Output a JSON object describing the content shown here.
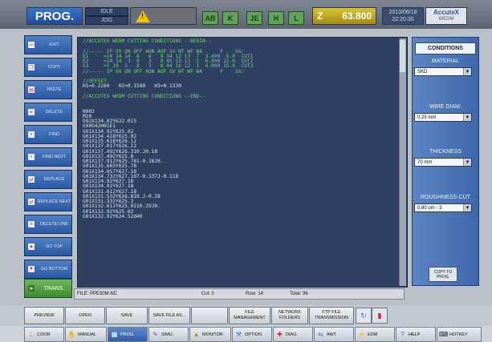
{
  "topbar": {
    "mode": "PROG.",
    "status_top": "IDLE",
    "status_bottom": "JOG",
    "warning_symbol": "!",
    "green_buttons": [
      "AB",
      "K",
      "JE",
      "H",
      "L"
    ],
    "counter_icon": "Z",
    "counter_value": "63.800",
    "date": "2013/06/18",
    "time": "22:20:30",
    "logo_brand": "AccuteX",
    "logo_sub": "WEDM"
  },
  "sidebar": {
    "items": [
      {
        "label": "EXIT",
        "icon": "exit-icon"
      },
      {
        "label": "COPY",
        "icon": "copy-icon"
      },
      {
        "label": "PASTE",
        "icon": "paste-icon"
      },
      {
        "label": "DELETE",
        "icon": "delete-icon"
      },
      {
        "label": "FIND",
        "icon": "find-icon"
      },
      {
        "label": "FIND NEXT",
        "icon": "find-next-icon"
      },
      {
        "label": "REPLACE",
        "icon": "replace-icon"
      },
      {
        "label": "REPLACE NEXT",
        "icon": "replace-next-icon"
      },
      {
        "label": "DELETE LINE",
        "icon": "delete-line-icon"
      },
      {
        "label": "GO TOP",
        "icon": "go-top-icon"
      },
      {
        "label": "GO BOTTOM",
        "icon": "go-bottom-icon"
      },
      {
        "label": "TRANS.",
        "icon": "trans-icon"
      }
    ]
  },
  "editor": {
    "lines": [
      {
        "text": "//ACCUTEX WEDM CUTTING CONDITIONS --BEGIN--",
        "color": "green"
      },
      {
        "text": "",
        "color": "green"
      },
      {
        "text": "//----- IP OV ON OFF AON AOF SV WT WF WA      F    SG:",
        "color": "green"
      },
      {
        "text": "E1     =10 14 14  8   6   8 34 12 13  7  3.400  6.0  CUT1",
        "color": "green"
      },
      {
        "text": "E2     =10 14  3  8   3   8 45 13 13  1  6.000 11.0  CUT2",
        "color": "green"
      },
      {
        "text": "E3     =1 10  3   8   3   8 44 16 12  1  6.000 15.0  CUT3",
        "color": "green"
      },
      {
        "text": "//----- IP OV ON OFF AON AOF SV WT WF WA      F    SG:",
        "color": "green"
      },
      {
        "text": "",
        "color": "green"
      },
      {
        "text": "//OFFSET",
        "color": "green"
      },
      {
        "text": "H1=0.2260   H2=0.1580   H3=0.1330",
        "color": "white"
      },
      {
        "text": "",
        "color": "green"
      },
      {
        "text": "//ACCUTEX WEDM CUTTING CONDITIONS --END--",
        "color": "green"
      },
      {
        "text": "",
        "color": "green"
      },
      {
        "text": "",
        "color": "green"
      },
      {
        "text": "N002",
        "color": "white"
      },
      {
        "text": "M20",
        "color": "white"
      },
      {
        "text": "G92X134.02Y622.015",
        "color": "white"
      },
      {
        "text": "G90G42H01E1",
        "color": "white"
      },
      {
        "text": "G01X134.92Y625.02",
        "color": "white"
      },
      {
        "text": "G01X134.418Y625.02",
        "color": "white"
      },
      {
        "text": "G01X135.618Y626.12",
        "color": "white"
      },
      {
        "text": "G01X137.017Y626.12",
        "color": "white"
      },
      {
        "text": "G01X137.492Y626.310.J0.18",
        "color": "white"
      },
      {
        "text": "G01X137.492Y625.8",
        "color": "white"
      },
      {
        "text": "G01X137.912Y625.781-0.18J0.",
        "color": "white"
      },
      {
        "text": "G01X135.603Y625.78",
        "color": "white"
      },
      {
        "text": "G01X134.057Y627.18",
        "color": "white"
      },
      {
        "text": "G03X134.732Y627.107-0.137J-0.118",
        "color": "white"
      },
      {
        "text": "G01X134.92Y627.18",
        "color": "white"
      },
      {
        "text": "G01X134.92Y627.18",
        "color": "white"
      },
      {
        "text": "G01X131.612Y627.18",
        "color": "white"
      },
      {
        "text": "G01X131.532Y626.810.J-0.28",
        "color": "white"
      },
      {
        "text": "G01X131.332Y625.3",
        "color": "white"
      },
      {
        "text": "G01X132.612Y625.0210.29J0.",
        "color": "white"
      },
      {
        "text": "G01X132.92Y625.02",
        "color": "white"
      },
      {
        "text": "G01X132.92Y624.52d40",
        "color": "white"
      }
    ]
  },
  "filebar": {
    "file": "FILE: PPE30M.NC",
    "col": "Col: 0",
    "row": "Row: 14",
    "total": "Total: 96"
  },
  "conditions": {
    "title": "CONDITIONS",
    "material_label": "MATERIAL",
    "material_value": "SKD",
    "wire_label": "WIRE DIAM.",
    "wire_value": "0.25 mm",
    "thickness_label": "THICKNESS",
    "thickness_value": "70 mm",
    "roughness_label": "ROUGHNESS-CUT",
    "roughness_value": "0.80 um - 3",
    "copy_button": "COPY TO PROG."
  },
  "function_bar": {
    "buttons": [
      "PREVIEW",
      "OPEN",
      "SAVE",
      "SAVE FILE AS...",
      "",
      "FILE MANAGEMENT",
      "NETWORK FOLDERS",
      "FTP FILE TRANSMISSION"
    ]
  },
  "nav": {
    "items": [
      {
        "label": "COOR",
        "icon": "coor-icon"
      },
      {
        "label": "MANUAL",
        "icon": "manual-icon"
      },
      {
        "label": "PROG.",
        "icon": "prog-icon"
      },
      {
        "label": "SIMU.",
        "icon": "simu-icon"
      },
      {
        "label": "MONITOR",
        "icon": "monitor-icon"
      },
      {
        "label": "OPTION",
        "icon": "option-icon"
      },
      {
        "label": "DIAG.",
        "icon": "diag-icon"
      },
      {
        "label": "AWT",
        "icon": "awt-icon"
      },
      {
        "label": "EDM",
        "icon": "edm-icon"
      },
      {
        "label": "HELP",
        "icon": "help-icon"
      },
      {
        "label": "HOTKEY",
        "icon": "hotkey-icon"
      }
    ]
  }
}
